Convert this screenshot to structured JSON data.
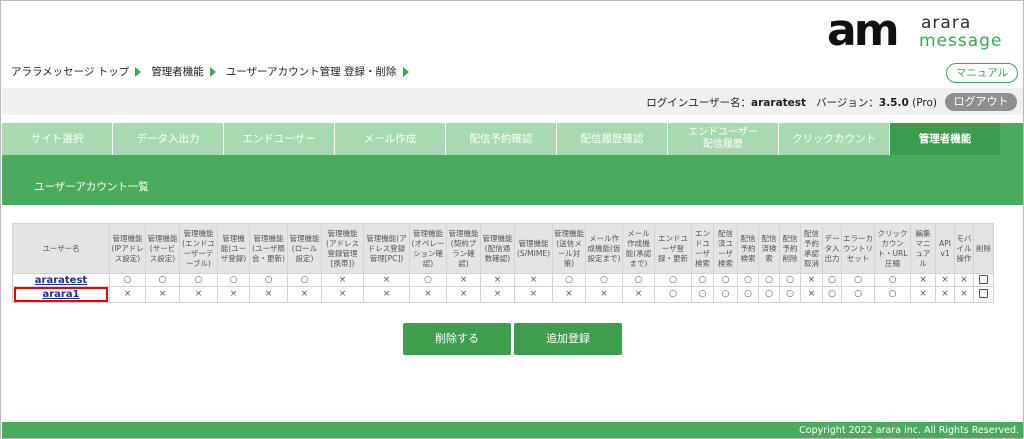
{
  "logo": {
    "mark": "am",
    "line1": "arara",
    "line2": "message"
  },
  "breadcrumb": [
    "アララメッセージ トップ",
    "管理者機能",
    "ユーザーアカウント管理 登録・削除"
  ],
  "manual_label": "マニュアル",
  "info": {
    "login_label": "ログインユーザー名：",
    "login_user": "araratest",
    "version_label": "バージョン：",
    "version": "3.5.0",
    "edition": "(Pro)"
  },
  "logout_label": "ログアウト",
  "tabs": [
    {
      "label": "サイト選択"
    },
    {
      "label": "データ入出力"
    },
    {
      "label": "エンドユーザー"
    },
    {
      "label": "メール作成"
    },
    {
      "label": "配信予約確認"
    },
    {
      "label": "配信履歴確認"
    },
    {
      "label": "エンドユーザー\n配信履歴"
    },
    {
      "label": "クリックカウント"
    },
    {
      "label": "管理者機能"
    }
  ],
  "section_title": "ユーザーアカウント一覧",
  "table": {
    "headers": [
      "ユーザー名",
      "管理機能(IPアドレス設定)",
      "管理機能(サービス設定)",
      "管理機能(エンドユーザーテーブル)",
      "管理機能(ユーザ登録)",
      "管理機能(ユーザ照会・更新)",
      "管理機能(ロール設定)",
      "管理機能(アドレス登録管理[携帯])",
      "管理機能(アドレス登録管理[PC])",
      "管理機能(オペレーション確認)",
      "管理機能(契約プラン確認)",
      "管理機能(配信通数確認)",
      "管理機能(S/MIME)",
      "管理機能(送信メール対策)",
      "メール作成機能(仮設定まで)",
      "メール作成機能(承認まで)",
      "エンドユーザ登録・更新",
      "エンドユーザ検索",
      "配信済ユーザ検索",
      "配信予約検索",
      "配信済検索",
      "配信予約削除",
      "配信予約承認取消",
      "データ入出力",
      "エラーカウントリセット",
      "クリックカウント・URL圧縮",
      "編集マニュアル",
      "API v1",
      "モバイル操作",
      "削除"
    ],
    "rows": [
      {
        "user": "araratest",
        "cells": [
          "○",
          "○",
          "○",
          "○",
          "○",
          "○",
          "×",
          "×",
          "○",
          "×",
          "×",
          "×",
          "○",
          "○",
          "○",
          "○",
          "○",
          "○",
          "○",
          "○",
          "○",
          "×",
          "○",
          "○",
          "○",
          "×",
          "×",
          "×"
        ]
      },
      {
        "user": "arara1",
        "cells": [
          "×",
          "×",
          "×",
          "×",
          "×",
          "×",
          "×",
          "×",
          "×",
          "×",
          "×",
          "×",
          "×",
          "×",
          "×",
          "○",
          "○",
          "○",
          "○",
          "○",
          "○",
          "×",
          "○",
          "○",
          "○",
          "×",
          "×",
          "×"
        ]
      }
    ]
  },
  "buttons": {
    "delete": "削除する",
    "add": "追加登録"
  },
  "footer": "Copyright 2022 arara inc. All Rights Reserved."
}
